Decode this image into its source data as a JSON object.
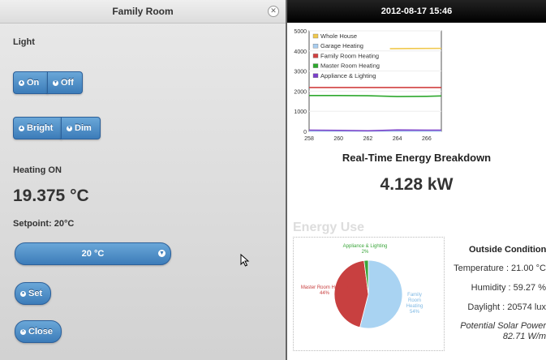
{
  "dialog": {
    "title": "Family Room",
    "light_label": "Light",
    "on_label": "On",
    "off_label": "Off",
    "bright_label": "Bright",
    "dim_label": "Dim",
    "heating_status": "Heating ON",
    "current_temp": "19.375 °C",
    "setpoint_label": "Setpoint: 20°C",
    "setpoint_selected": "20 °C",
    "set_label": "Set",
    "close_label": "Close"
  },
  "dashboard": {
    "datetime": "2012-08-17 15:46",
    "realtime_title": "Real-Time Energy Breakdown",
    "realtime_value": "4.128 kW",
    "energy_use_title": "Energy Use",
    "outside": {
      "title": "Outside Conditions",
      "temperature": "Temperature : 21.00 °C",
      "humidity": "Humidity : 59.27 %",
      "daylight": "Daylight : 20574 lux",
      "solar_1": "Potential Solar Power",
      "solar_2": "82.71 W/m"
    }
  },
  "chart_data": [
    {
      "type": "line",
      "x": [
        258,
        260,
        262,
        264,
        266,
        267
      ],
      "xlim": [
        258,
        267
      ],
      "ylim": [
        0,
        5000
      ],
      "yticks": [
        0,
        1000,
        2000,
        3000,
        4000,
        5000
      ],
      "xticks": [
        258,
        260,
        262,
        264,
        266
      ],
      "legend_position": "top-left",
      "series": [
        {
          "name": "Whole House",
          "color": "#f0c84c",
          "points": [
            [
              263.5,
              4110
            ],
            [
              265,
              4120
            ],
            [
              267,
              4128
            ]
          ]
        },
        {
          "name": "Garage Heating",
          "color": "#a9cdef",
          "points": [
            [
              258,
              10
            ],
            [
              267,
              10
            ]
          ]
        },
        {
          "name": "Family Room Heating",
          "color": "#d04040",
          "points": [
            [
              258,
              2180
            ],
            [
              260,
              2180
            ],
            [
              262,
              2180
            ],
            [
              264,
              2180
            ],
            [
              266,
              2180
            ],
            [
              267,
              2180
            ]
          ]
        },
        {
          "name": "Master Room Heating",
          "color": "#2da82d",
          "points": [
            [
              258,
              1780
            ],
            [
              260,
              1780
            ],
            [
              262,
              1770
            ],
            [
              264,
              1730
            ],
            [
              266,
              1740
            ],
            [
              267,
              1760
            ]
          ]
        },
        {
          "name": "Appliance & Lighting",
          "color": "#7a3fc9",
          "points": [
            [
              258,
              60
            ],
            [
              260,
              50
            ],
            [
              262,
              30
            ],
            [
              264,
              70
            ],
            [
              266,
              60
            ],
            [
              267,
              60
            ]
          ]
        }
      ]
    },
    {
      "type": "pie",
      "slices": [
        {
          "label": "Family Room Heating",
          "pct_label": "54%",
          "value": 54,
          "color": "#a9d3f2"
        },
        {
          "label": "Master Room Heating",
          "pct_label": "44%",
          "value": 44,
          "color": "#c84040"
        },
        {
          "label": "Appliance & Lighting",
          "pct_label": "2%",
          "value": 2,
          "color": "#3aa53a"
        }
      ]
    }
  ]
}
